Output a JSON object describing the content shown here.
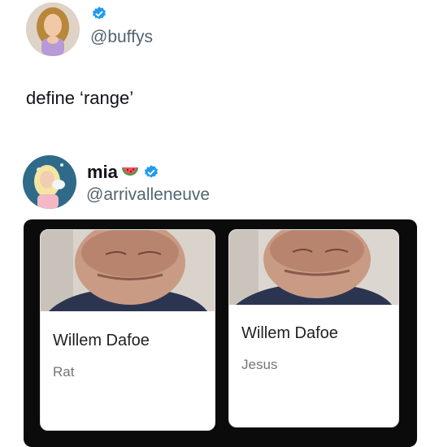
{
  "post1": {
    "handle": "@buffys",
    "text": "define ‘range’"
  },
  "post2": {
    "display_name": "mia",
    "emoji_icon": "watermelon-icon",
    "handle": "@arrivalleneuve"
  },
  "cards": [
    {
      "name": "Willem Dafoe",
      "role": "Rat"
    },
    {
      "name": "Willem Dafoe",
      "role": "Jesus"
    }
  ],
  "colors": {
    "verified_blue": "#1d9bf0",
    "handle_gray": "#536471",
    "frame_dark": "#0b0b0b"
  }
}
